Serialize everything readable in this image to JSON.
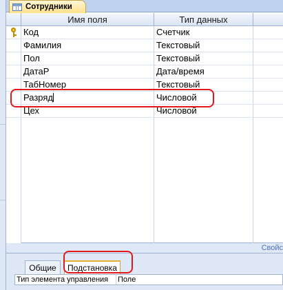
{
  "document_tab": {
    "label": "Сотрудники",
    "icon": "table-icon"
  },
  "grid": {
    "columns": [
      "Имя поля",
      "Тип данных"
    ],
    "rows": [
      {
        "name": "Код",
        "type": "Счетчик",
        "primary_key": true
      },
      {
        "name": "Фамилия",
        "type": "Текстовый"
      },
      {
        "name": "Пол",
        "type": "Текстовый"
      },
      {
        "name": "ДатаР",
        "type": "Дата/время"
      },
      {
        "name": "ТабНомер",
        "type": "Текстовый"
      },
      {
        "name": "Разряд",
        "type": "Числовой",
        "editing": true
      },
      {
        "name": "Цех",
        "type": "Числовой"
      }
    ]
  },
  "properties": {
    "label": "Свойс",
    "tabs": [
      "Общие",
      "Подстановка"
    ],
    "active_tab": "Подстановка",
    "row": {
      "label": "Тип элемента управления",
      "value": "Поле"
    }
  },
  "colors": {
    "highlight": "#e0181b",
    "header": "#d9e4f3",
    "tab_active": "#ffe28a"
  }
}
